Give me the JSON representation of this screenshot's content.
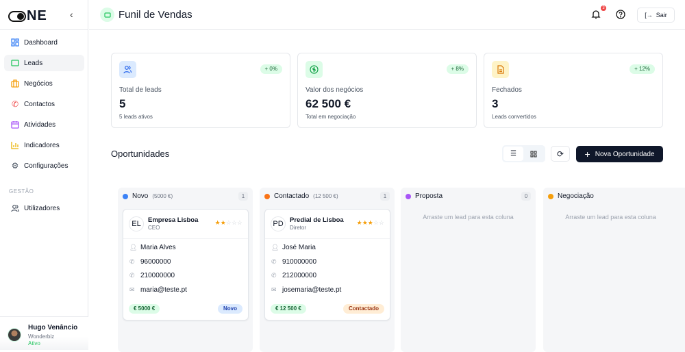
{
  "app": {
    "logo": "ONE",
    "user": {
      "name": "Hugo Venâncio",
      "company": "Wonderbiz",
      "status": "Ativo"
    }
  },
  "sidebar": {
    "items": [
      {
        "label": "Dashboard"
      },
      {
        "label": "Leads"
      },
      {
        "label": "Negócios"
      },
      {
        "label": "Contactos"
      },
      {
        "label": "Atividades"
      },
      {
        "label": "Indicadores"
      },
      {
        "label": "Configurações"
      }
    ],
    "section": "GESTÃO",
    "section_items": [
      {
        "label": "Utilizadores"
      }
    ]
  },
  "header": {
    "title": "Funil de Vendas",
    "notifications": "3",
    "logout": "Sair"
  },
  "stats": [
    {
      "label": "Total de leads",
      "value": "5",
      "sub": "5 leads ativos",
      "change": "+ 0%"
    },
    {
      "label": "Valor dos negócios",
      "value": "62 500 €",
      "sub": "Total em negociação",
      "change": "+ 8%"
    },
    {
      "label": "Fechados",
      "value": "3",
      "sub": "Leads convertidos",
      "change": "+ 12%"
    }
  ],
  "opportunities": {
    "title": "Oportunidades",
    "new_button": "Nova Oportunidade"
  },
  "columns": [
    {
      "name": "Novo",
      "amount": "(5000 €)",
      "count": "1",
      "color": "#3b82f6",
      "card": {
        "initials": "EL",
        "company": "Empresa Lisboa",
        "role": "CEO",
        "rating": 2,
        "contact": "Maria Alves",
        "phone1": "96000000",
        "phone2": "210000000",
        "email": "maria@teste.pt",
        "value": "€ 5000 €",
        "status": "Novo"
      }
    },
    {
      "name": "Contactado",
      "amount": "(12 500 €)",
      "count": "1",
      "color": "#f97316",
      "card": {
        "initials": "PD",
        "company": "Predial de Lisboa",
        "role": "Diretor",
        "rating": 3,
        "contact": "José Maria",
        "phone1": "910000000",
        "phone2": "212000000",
        "email": "josemaria@teste.pt",
        "value": "€ 12 500 €",
        "status": "Contactado"
      }
    },
    {
      "name": "Proposta",
      "count": "0",
      "color": "#a855f7",
      "empty": "Arraste um lead para esta coluna"
    },
    {
      "name": "Negociação",
      "color": "#f59e0b",
      "empty": "Arraste um lead para esta coluna"
    }
  ]
}
